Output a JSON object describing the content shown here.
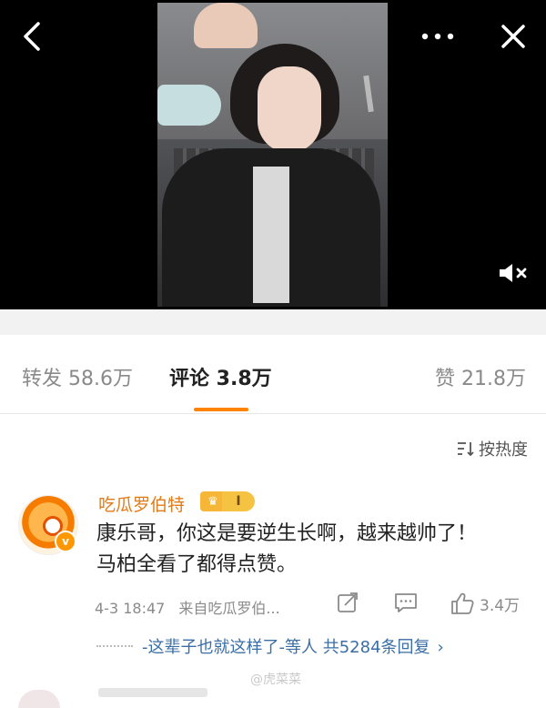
{
  "stats": {
    "repost": "转发 58.6万",
    "comment": "评论 3.8万",
    "like": "赞 21.8万"
  },
  "sort_label": "按热度",
  "comment": {
    "username": "吃瓜罗伯特",
    "level_badge": "I",
    "text_line1": "康乐哥，你这是要逆生长啊，越来越帅了！",
    "text_line2": "马柏全看了都得点赞。",
    "timestamp": "4-3 18:47",
    "source": "来自吃瓜罗伯...",
    "like_count": "3.4万",
    "reply_summary": "-这辈子也就这样了-等人 共5284条回复"
  },
  "watermark": "@虎菜菜",
  "colors": {
    "accent": "#ff8200",
    "username": "#e07b1a",
    "link": "#3b6ea5"
  }
}
